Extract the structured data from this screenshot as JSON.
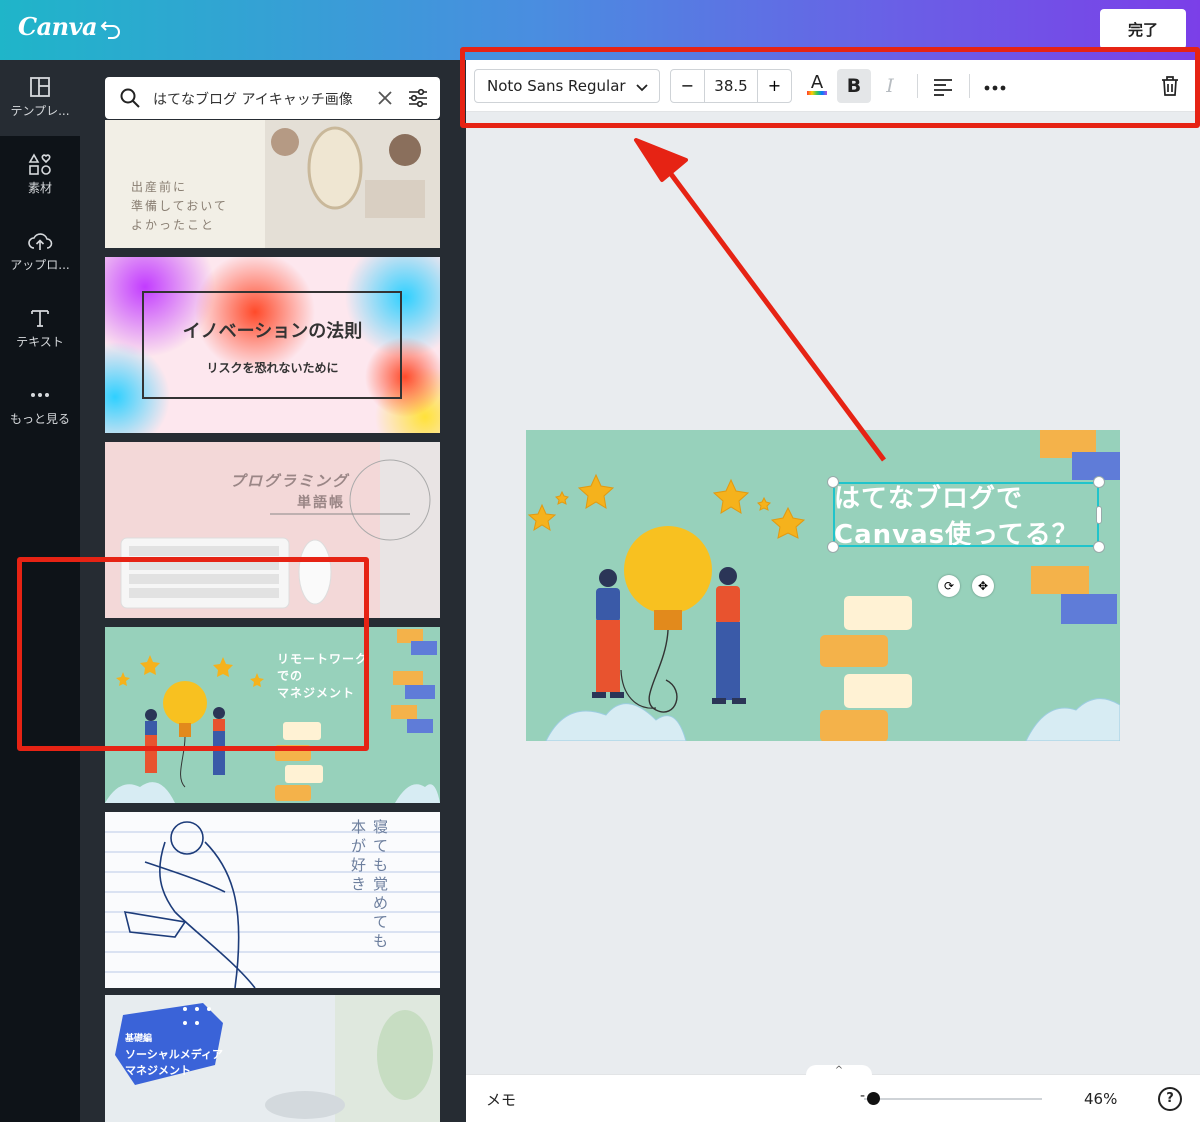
{
  "header": {
    "logo": "Canva",
    "done_label": "完了"
  },
  "rail": {
    "items": [
      {
        "label": "テンプレ..."
      },
      {
        "label": "素材"
      },
      {
        "label": "アップロ..."
      },
      {
        "label": "テキスト"
      },
      {
        "label": "もっと見る"
      }
    ]
  },
  "search": {
    "value": "はてなブログ アイキャッチ画像"
  },
  "templates": [
    {
      "text": [
        "出産前に",
        "準備しておいて",
        "よかったこと"
      ]
    },
    {
      "title": "イノベーションの法則",
      "subtitle": "リスクを恐れないために"
    },
    {
      "title": "プログラミング",
      "subtitle": "単語帳"
    },
    {
      "text": [
        "リモートワーク",
        "での",
        "マネジメント"
      ]
    },
    {
      "text": [
        "寝ても覚めても",
        "本が好き"
      ]
    },
    {
      "tag": "基礎編",
      "text": [
        "ソーシャルメディア",
        "マネジメント"
      ]
    }
  ],
  "toolbar": {
    "font": "Noto Sans Regular",
    "size_minus": "−",
    "size": "38.5",
    "size_plus": "+",
    "color_a": "A",
    "bold": "B",
    "italic": "I"
  },
  "design": {
    "line1": "はてなブログで",
    "line2": "Canvas使ってる？"
  },
  "footer": {
    "memo": "メモ",
    "zoom_minus": "-",
    "zoom": "46%",
    "help": "?"
  },
  "colors": {
    "accent_red": "#e62314",
    "teal_bg": "#97d1bb",
    "selection": "#20c4cb"
  }
}
